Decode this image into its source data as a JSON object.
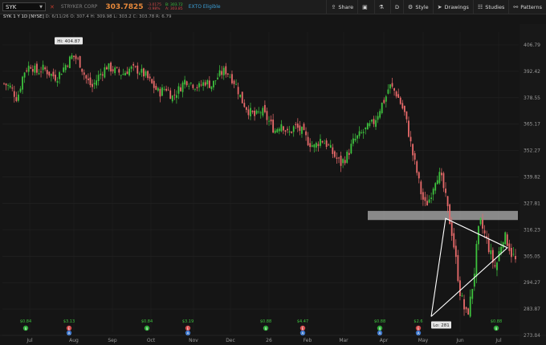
{
  "toolbar": {
    "symbol": "SYK",
    "company": "STRYKER CORP",
    "last_price": "303.7825",
    "change": "-3.0175",
    "change_pct": "-0.98%",
    "bid": "B: 303.72",
    "ask": "A: 303.85",
    "etb": "EXTO Eligible",
    "share_label": "Share",
    "aggregation": "D",
    "style_label": "Style",
    "drawings_label": "Drawings",
    "studies_label": "Studies",
    "patterns_label": "Patterns"
  },
  "info_bar": {
    "symbol_desc": "SYK 1 Y 1D [NYSE]",
    "ohlc": "D: 6/11/26   O: 307.4   H: 309.98   L: 303.2   C: 303.78   R: 6.79"
  },
  "colors": {
    "up": "#3ec23e",
    "down": "#e86a6a",
    "price_tag": "#e86a6a",
    "zone": "#c8c8c8",
    "bg": "#151515"
  },
  "callouts": {
    "high": "Hi: 404.87",
    "low": "Lo: 281",
    "price_tag": "303.78"
  },
  "chart_data": {
    "type": "candlestick",
    "ylim": [
      270,
      412
    ],
    "y_ticks": [
      "406.79",
      "392.42",
      "378.55",
      "365.17",
      "352.27",
      "339.82",
      "327.81",
      "316.23",
      "305.05",
      "294.27",
      "283.87",
      "273.84"
    ],
    "x_ticks": [
      "Jul",
      "Aug",
      "Sep",
      "Oct",
      "Nov",
      "Dec",
      "26",
      "Feb",
      "Mar",
      "Apr",
      "May",
      "Jun",
      "Jul"
    ],
    "high": 404.87,
    "low": 281,
    "last": 303.78,
    "resistance_zone": [
      320.5,
      324.5
    ],
    "path": [
      [
        0,
        386
      ],
      [
        5,
        384
      ],
      [
        10,
        378
      ],
      [
        15,
        392
      ],
      [
        20,
        396
      ],
      [
        25,
        392
      ],
      [
        30,
        394
      ],
      [
        35,
        391
      ],
      [
        40,
        389
      ],
      [
        45,
        394
      ],
      [
        52,
        401
      ],
      [
        57,
        398
      ],
      [
        62,
        389
      ],
      [
        67,
        384
      ],
      [
        72,
        390
      ],
      [
        78,
        395
      ],
      [
        84,
        393
      ],
      [
        90,
        391
      ],
      [
        96,
        394
      ],
      [
        102,
        393
      ],
      [
        108,
        390
      ],
      [
        112,
        386
      ],
      [
        118,
        381
      ],
      [
        123,
        384
      ],
      [
        128,
        379
      ],
      [
        133,
        383
      ],
      [
        138,
        388
      ],
      [
        143,
        386
      ],
      [
        148,
        384
      ],
      [
        153,
        387
      ],
      [
        158,
        385
      ],
      [
        163,
        390
      ],
      [
        168,
        393
      ],
      [
        171,
        391
      ],
      [
        176,
        386
      ],
      [
        181,
        377
      ],
      [
        186,
        372
      ],
      [
        191,
        369
      ],
      [
        196,
        372
      ],
      [
        201,
        367
      ],
      [
        206,
        362
      ],
      [
        211,
        366
      ],
      [
        216,
        360
      ],
      [
        221,
        364
      ],
      [
        226,
        362
      ],
      [
        231,
        357
      ],
      [
        236,
        354
      ],
      [
        241,
        358
      ],
      [
        246,
        355
      ],
      [
        251,
        350
      ],
      [
        256,
        346
      ],
      [
        261,
        350
      ],
      [
        266,
        357
      ],
      [
        271,
        360
      ],
      [
        276,
        363
      ],
      [
        281,
        366
      ],
      [
        284,
        370
      ],
      [
        287,
        375
      ],
      [
        290,
        378
      ],
      [
        293,
        385
      ],
      [
        296,
        383
      ],
      [
        299,
        380
      ],
      [
        302,
        375
      ],
      [
        305,
        370
      ],
      [
        308,
        360
      ],
      [
        311,
        350
      ],
      [
        314,
        342
      ],
      [
        317,
        333
      ],
      [
        320,
        327
      ],
      [
        323,
        329
      ],
      [
        326,
        335
      ],
      [
        329,
        341
      ],
      [
        332,
        340
      ],
      [
        335,
        333
      ],
      [
        338,
        323
      ],
      [
        341,
        314
      ],
      [
        344,
        302
      ],
      [
        347,
        290
      ],
      [
        350,
        284
      ],
      [
        352,
        281
      ],
      [
        355,
        288
      ],
      [
        358,
        300
      ],
      [
        360,
        312
      ],
      [
        362,
        320
      ],
      [
        365,
        315
      ],
      [
        368,
        310
      ],
      [
        371,
        304
      ],
      [
        374,
        300
      ],
      [
        377,
        308
      ],
      [
        380,
        314
      ],
      [
        383,
        311
      ],
      [
        386,
        306
      ],
      [
        389,
        303.8
      ]
    ],
    "events": [
      {
        "value": "$0.84",
        "type": "dividend",
        "icons": [
          "$"
        ]
      },
      {
        "value": "$3.13",
        "type": "earnings",
        "icons": [
          "E",
          "A"
        ]
      },
      {
        "value": "$0.84",
        "type": "dividend",
        "icons": [
          "$"
        ]
      },
      {
        "value": "$3.19",
        "type": "earnings",
        "icons": [
          "E",
          "A"
        ]
      },
      {
        "value": "$0.88",
        "type": "dividend",
        "icons": [
          "$"
        ]
      },
      {
        "value": "$4.47",
        "type": "earnings",
        "icons": [
          "E",
          "A"
        ]
      },
      {
        "value": "$0.88",
        "type": "dividend",
        "icons": [
          "$",
          "A"
        ]
      },
      {
        "value": "$2.6",
        "type": "earnings",
        "icons": [
          "E",
          "A"
        ]
      },
      {
        "value": "$0.88",
        "type": "dividend",
        "icons": [
          "$"
        ]
      }
    ]
  }
}
